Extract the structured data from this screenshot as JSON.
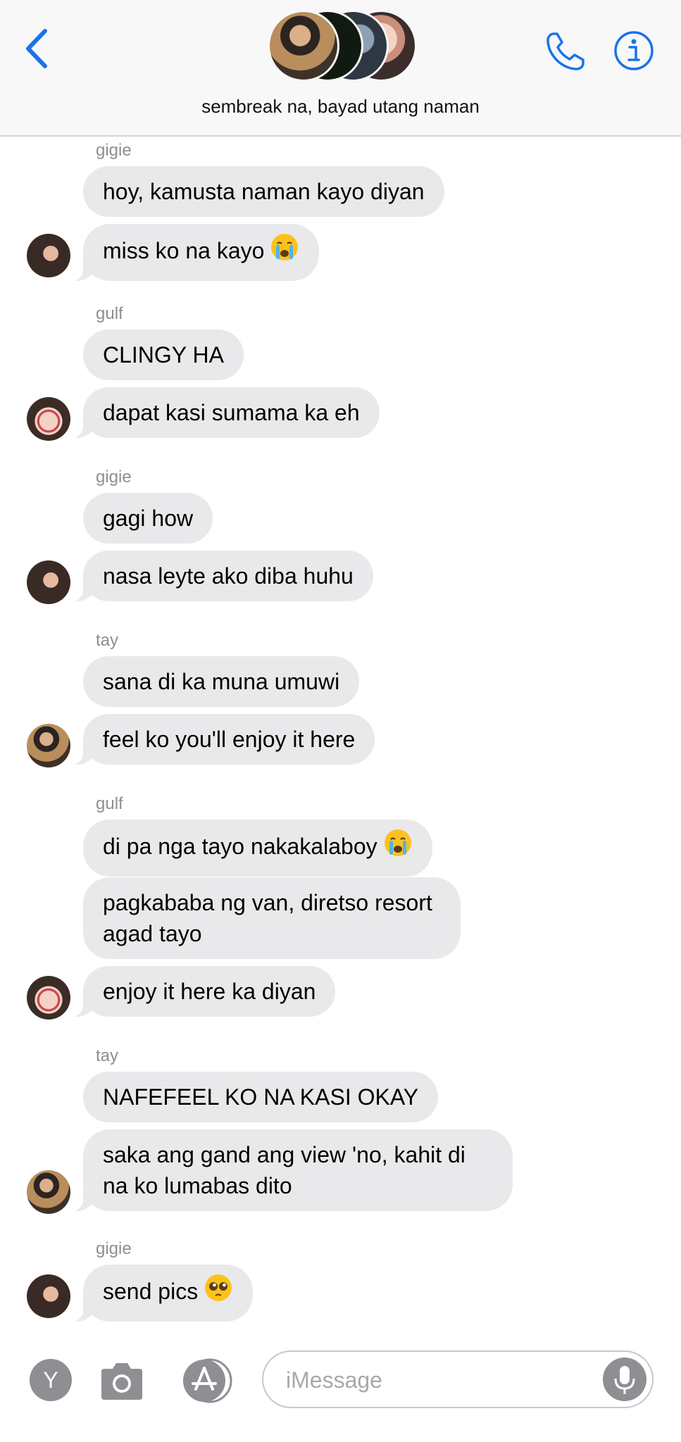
{
  "header": {
    "group_name": "sembreak na, bayad utang naman",
    "back_icon": "chevron-left-icon",
    "call_icon": "phone-icon",
    "info_icon": "info-icon",
    "accent_color": "#1a73e8"
  },
  "messages": [
    {
      "sender": "gigie",
      "text": "hoy, kamusta naman kayo diyan"
    },
    {
      "text": "miss ko na kayo",
      "emoji": "loudly-crying-face"
    },
    {
      "sender": "gulf",
      "text": "CLINGY HA"
    },
    {
      "text": "dapat kasi sumama ka eh"
    },
    {
      "sender": "gigie",
      "text": "gagi how"
    },
    {
      "text": "nasa leyte ako diba huhu"
    },
    {
      "sender": "tay",
      "text": "sana di ka muna umuwi"
    },
    {
      "text": "feel ko you'll enjoy it here"
    },
    {
      "sender": "gulf",
      "text": "di pa nga tayo nakakalaboy",
      "emoji": "loudly-crying-face"
    },
    {
      "text": "pagkababa ng van, diretso resort agad tayo"
    },
    {
      "text": "enjoy it here ka diyan"
    },
    {
      "sender": "tay",
      "text": "NAFEFEEL KO NA KASI OKAY"
    },
    {
      "text": "saka ang gand ang view 'no, kahit di na ko lumabas dito"
    },
    {
      "sender": "gigie",
      "text": "send pics",
      "emoji": "pleading-face"
    }
  ],
  "input_bar": {
    "apps_label": "Y",
    "placeholder": "iMessage",
    "camera_icon": "camera-icon",
    "appstore_icon": "app-store-icon",
    "mic_icon": "microphone-icon"
  },
  "colors": {
    "bubble_gray": "#e9e9eb",
    "sender_gray": "#8e8e93",
    "icon_gray": "#8e8e93"
  }
}
